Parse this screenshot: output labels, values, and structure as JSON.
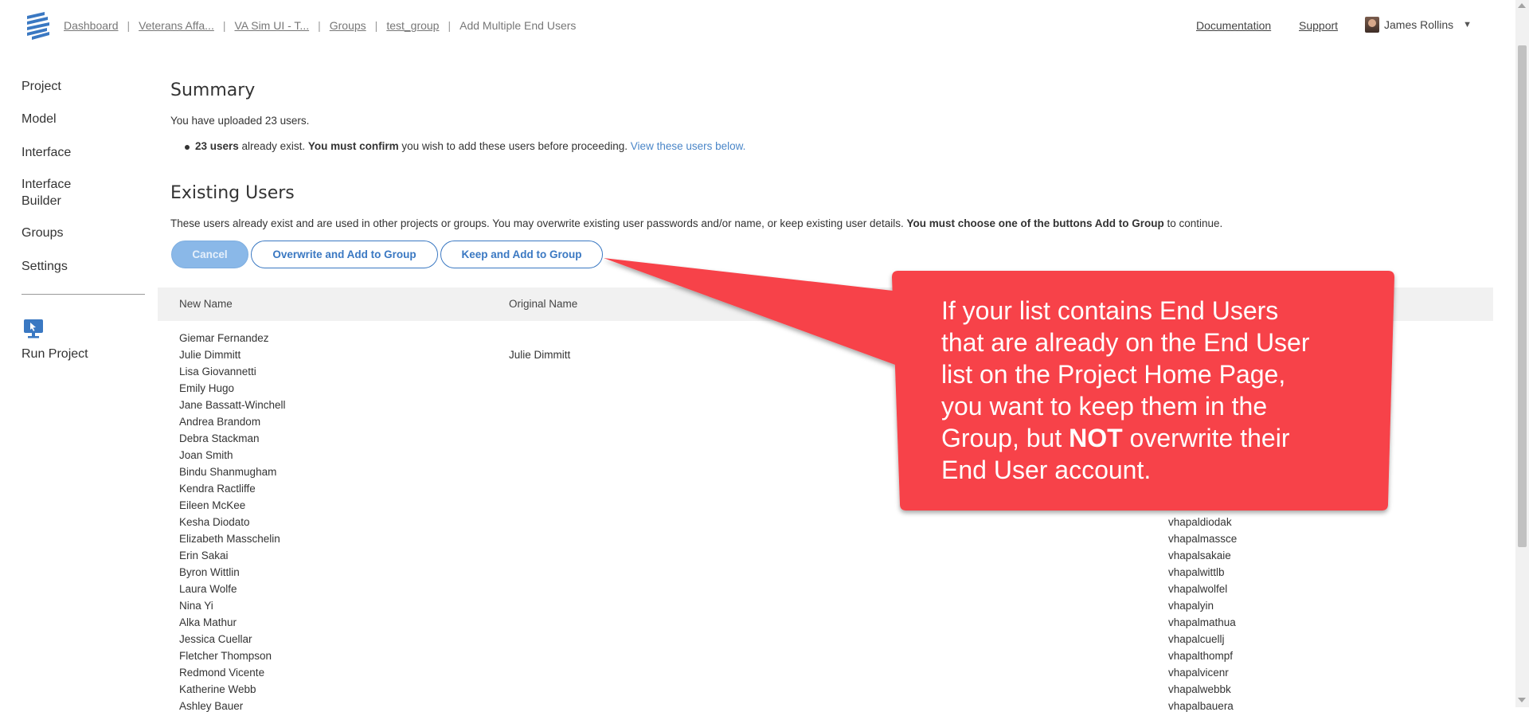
{
  "header": {
    "breadcrumbs": [
      "Dashboard",
      "Veterans Affa...",
      "VA Sim UI - T...",
      "Groups",
      "test_group"
    ],
    "current_page": "Add Multiple End Users",
    "separator": "|",
    "links": {
      "documentation": "Documentation",
      "support": "Support"
    },
    "user_name": "James Rollins"
  },
  "sidebar": {
    "items": [
      "Project",
      "Model",
      "Interface",
      "Interface Builder",
      "Groups",
      "Settings"
    ],
    "run_label": "Run Project"
  },
  "summary": {
    "title": "Summary",
    "uploaded_text": "You have uploaded 23 users.",
    "bullet_count": "23 users",
    "bullet_mid": " already exist. ",
    "bullet_bold": "You must confirm",
    "bullet_after": " you wish to add these users before proceeding. ",
    "bullet_link": "View these users below."
  },
  "existing": {
    "title": "Existing Users",
    "desc_plain": "These users already exist and are used in other projects or groups. You may overwrite existing user passwords and/or name, or keep existing user details. ",
    "desc_bold": "You must choose one of the buttons Add to Group",
    "desc_end": " to continue.",
    "buttons": {
      "cancel": "Cancel",
      "overwrite": "Overwrite and Add to Group",
      "keep": "Keep and Add to Group"
    }
  },
  "table": {
    "headers": [
      "New Name",
      "Original Name"
    ],
    "rows": [
      {
        "new_name": "Giemar Fernandez",
        "original_name": "",
        "username": ""
      },
      {
        "new_name": "Julie Dimmitt",
        "original_name": "Julie Dimmitt",
        "username": ""
      },
      {
        "new_name": "Lisa Giovannetti",
        "original_name": "",
        "username": ""
      },
      {
        "new_name": "Emily Hugo",
        "original_name": "",
        "username": ""
      },
      {
        "new_name": "Jane Bassatt-Winchell",
        "original_name": "",
        "username": ""
      },
      {
        "new_name": "Andrea Brandom",
        "original_name": "",
        "username": ""
      },
      {
        "new_name": "Debra Stackman",
        "original_name": "",
        "username": ""
      },
      {
        "new_name": "Joan Smith",
        "original_name": "",
        "username": ""
      },
      {
        "new_name": "Bindu Shanmugham",
        "original_name": "",
        "username": ""
      },
      {
        "new_name": "Kendra Ractliffe",
        "original_name": "",
        "username": ""
      },
      {
        "new_name": "Eileen McKee",
        "original_name": "",
        "username": ""
      },
      {
        "new_name": "Kesha Diodato",
        "original_name": "",
        "username": "vhapaldiodak"
      },
      {
        "new_name": "Elizabeth Masschelin",
        "original_name": "",
        "username": "vhapalmassce"
      },
      {
        "new_name": "Erin Sakai",
        "original_name": "",
        "username": "vhapalsakaie"
      },
      {
        "new_name": "Byron Wittlin",
        "original_name": "",
        "username": "vhapalwittlb"
      },
      {
        "new_name": "Laura Wolfe",
        "original_name": "",
        "username": "vhapalwolfel"
      },
      {
        "new_name": "Nina Yi",
        "original_name": "",
        "username": "vhapalyin"
      },
      {
        "new_name": "Alka Mathur",
        "original_name": "",
        "username": "vhapalmathua"
      },
      {
        "new_name": "Jessica Cuellar",
        "original_name": "",
        "username": "vhapalcuellj"
      },
      {
        "new_name": "Fletcher Thompson",
        "original_name": "",
        "username": "vhapalthompf"
      },
      {
        "new_name": "Redmond Vicente",
        "original_name": "",
        "username": "vhapalvicenr"
      },
      {
        "new_name": "Katherine Webb",
        "original_name": "",
        "username": "vhapalwebbk"
      },
      {
        "new_name": "Ashley Bauer",
        "original_name": "",
        "username": "vhapalbauera"
      }
    ]
  },
  "callout": {
    "line1": "If your list contains End Users",
    "line2": "that are already on the End User",
    "line3": "list on the Project Home Page,",
    "line4": "you want to keep them in the",
    "line5_pre": "Group, but ",
    "line5_bold": "NOT",
    "line5_post": " overwrite their",
    "line6": "End User account.",
    "color": "#f7434a"
  },
  "colors": {
    "accent": "#3a78c2",
    "link": "#4a86c8",
    "cancel_bg": "#8ab8e8",
    "logo": "#3a78c2"
  }
}
